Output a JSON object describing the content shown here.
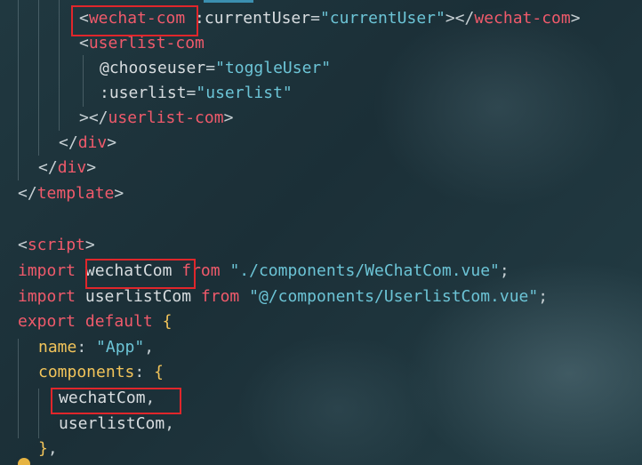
{
  "editor": {
    "lines": [
      {
        "tokens": [
          {
            "t": "<",
            "c": "tk-punct"
          },
          {
            "t": "wechat-com",
            "c": "tk-tag"
          },
          {
            "t": " :currentUser",
            "c": "tk-attr"
          },
          {
            "t": "=",
            "c": "tk-punct"
          },
          {
            "t": "\"currentUser\"",
            "c": "tk-str"
          },
          {
            "t": "></",
            "c": "tk-punct"
          },
          {
            "t": "wechat-com",
            "c": "tk-tag"
          },
          {
            "t": ">",
            "c": "tk-punct"
          }
        ]
      },
      {
        "tokens": [
          {
            "t": "<",
            "c": "tk-punct"
          },
          {
            "t": "userlist-com",
            "c": "tk-tag"
          }
        ]
      },
      {
        "tokens": [
          {
            "t": "@chooseuser",
            "c": "tk-attr"
          },
          {
            "t": "=",
            "c": "tk-punct"
          },
          {
            "t": "\"toggleUser\"",
            "c": "tk-str"
          }
        ]
      },
      {
        "tokens": [
          {
            "t": ":userlist",
            "c": "tk-attr"
          },
          {
            "t": "=",
            "c": "tk-punct"
          },
          {
            "t": "\"userlist\"",
            "c": "tk-str"
          }
        ]
      },
      {
        "tokens": [
          {
            "t": "></",
            "c": "tk-punct"
          },
          {
            "t": "userlist-com",
            "c": "tk-tag"
          },
          {
            "t": ">",
            "c": "tk-punct"
          }
        ]
      },
      {
        "tokens": [
          {
            "t": "</",
            "c": "tk-punct"
          },
          {
            "t": "div",
            "c": "tk-tag"
          },
          {
            "t": ">",
            "c": "tk-punct"
          }
        ]
      },
      {
        "tokens": [
          {
            "t": "</",
            "c": "tk-punct"
          },
          {
            "t": "div",
            "c": "tk-tag"
          },
          {
            "t": ">",
            "c": "tk-punct"
          }
        ]
      },
      {
        "tokens": [
          {
            "t": "</",
            "c": "tk-punct"
          },
          {
            "t": "template",
            "c": "tk-tag"
          },
          {
            "t": ">",
            "c": "tk-punct"
          }
        ]
      },
      {
        "tokens": []
      },
      {
        "tokens": [
          {
            "t": "<",
            "c": "tk-punct"
          },
          {
            "t": "script",
            "c": "tk-tag"
          },
          {
            "t": ">",
            "c": "tk-punct"
          }
        ]
      },
      {
        "tokens": [
          {
            "t": "import",
            "c": "tk-kw"
          },
          {
            "t": " wechatCom ",
            "c": "tk-id"
          },
          {
            "t": "from",
            "c": "tk-kw"
          },
          {
            "t": " \"./components/WeChatCom.vue\"",
            "c": "tk-str"
          },
          {
            "t": ";",
            "c": "tk-punct"
          }
        ]
      },
      {
        "tokens": [
          {
            "t": "import",
            "c": "tk-kw"
          },
          {
            "t": " userlistCom ",
            "c": "tk-id"
          },
          {
            "t": "from",
            "c": "tk-kw"
          },
          {
            "t": " \"@/components/UserlistCom.vue\"",
            "c": "tk-str"
          },
          {
            "t": ";",
            "c": "tk-punct"
          }
        ]
      },
      {
        "tokens": [
          {
            "t": "export",
            "c": "tk-kw"
          },
          {
            "t": " ",
            "c": "tk-id"
          },
          {
            "t": "default",
            "c": "tk-kw"
          },
          {
            "t": " ",
            "c": "tk-id"
          },
          {
            "t": "{",
            "c": "tk-brace"
          }
        ]
      },
      {
        "tokens": [
          {
            "t": "name",
            "c": "tk-key"
          },
          {
            "t": ": ",
            "c": "tk-punct"
          },
          {
            "t": "\"App\"",
            "c": "tk-str"
          },
          {
            "t": ",",
            "c": "tk-punct"
          }
        ]
      },
      {
        "tokens": [
          {
            "t": "components",
            "c": "tk-key"
          },
          {
            "t": ": ",
            "c": "tk-punct"
          },
          {
            "t": "{",
            "c": "tk-brace"
          }
        ]
      },
      {
        "tokens": [
          {
            "t": "wechatCom",
            "c": "tk-id"
          },
          {
            "t": ",",
            "c": "tk-punct"
          }
        ]
      },
      {
        "tokens": [
          {
            "t": "userlistCom",
            "c": "tk-id"
          },
          {
            "t": ",",
            "c": "tk-punct"
          }
        ]
      },
      {
        "tokens": [
          {
            "t": "}",
            "c": "tk-brace"
          },
          {
            "t": ",",
            "c": "tk-punct"
          }
        ]
      }
    ]
  }
}
